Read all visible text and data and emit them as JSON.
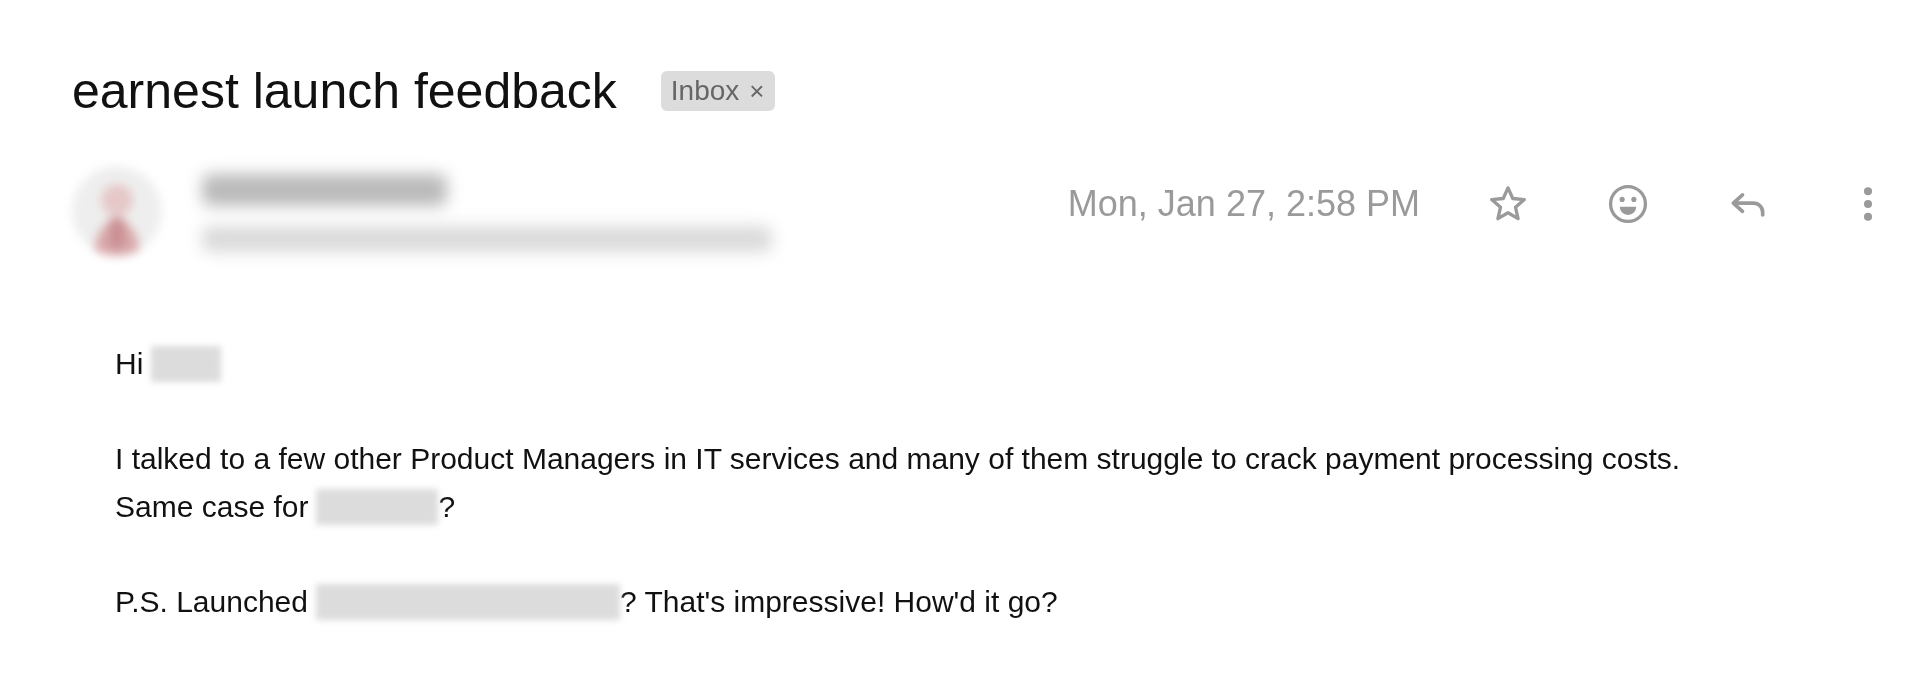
{
  "subject": "earnest launch feedback",
  "label": {
    "text": "Inbox",
    "remove": "×"
  },
  "sender": {
    "name": {
      "kind": "redacted"
    },
    "email": {
      "kind": "redacted"
    }
  },
  "date": "Mon, Jan 27, 2:58 PM",
  "actions": [
    {
      "kind": "star"
    },
    {
      "kind": "emoji"
    },
    {
      "kind": "reply"
    },
    {
      "kind": "more"
    }
  ],
  "body": [
    [
      [
        {
          "kind": "text",
          "text": "Hi"
        },
        {
          "kind": "redacted"
        }
      ]
    ],
    [
      [
        {
          "kind": "text",
          "text": "I talked to a few other Product Managers in IT services and many of them struggle to crack payment processing costs."
        }
      ],
      [
        {
          "kind": "text",
          "text": "Same case for"
        },
        {
          "kind": "redacted"
        },
        {
          "kind": "text",
          "text": "?"
        }
      ]
    ],
    [
      [
        {
          "kind": "text",
          "text": "P.S. Launched"
        },
        {
          "kind": "redacted"
        },
        {
          "kind": "text",
          "text": "? That's impressive! How'd it go?"
        }
      ]
    ]
  ]
}
